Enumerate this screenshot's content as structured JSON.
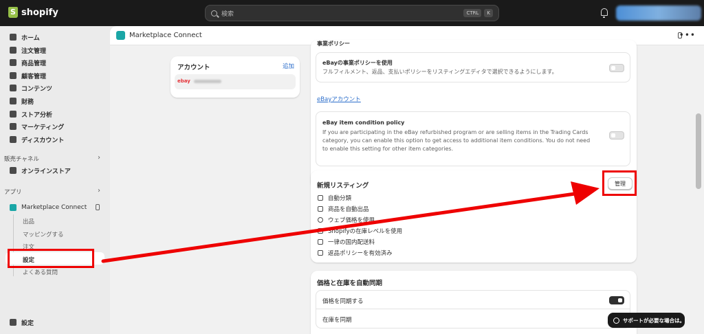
{
  "topbar": {
    "brand": "shopify",
    "search_placeholder": "検索",
    "kbd_ctrl": "CTRL",
    "kbd_k": "K"
  },
  "sidebar": {
    "items": [
      {
        "label": "ホーム",
        "icon": "home-icon"
      },
      {
        "label": "注文管理",
        "icon": "inbox-icon"
      },
      {
        "label": "商品管理",
        "icon": "tag-icon"
      },
      {
        "label": "顧客管理",
        "icon": "person-icon"
      },
      {
        "label": "コンテンツ",
        "icon": "image-icon"
      },
      {
        "label": "財務",
        "icon": "bank-icon"
      },
      {
        "label": "ストア分析",
        "icon": "chart-icon"
      },
      {
        "label": "マーケティング",
        "icon": "target-icon"
      },
      {
        "label": "ディスカウント",
        "icon": "discount-icon"
      }
    ],
    "sales_channels_label": "販売チャネル",
    "online_store": "オンラインストア",
    "apps_label": "アプリ",
    "app_name": "Marketplace Connect",
    "app_sub": [
      "出品",
      "マッピングする",
      "注文",
      "設定",
      "よくある質問"
    ],
    "settings": "設定"
  },
  "app_header": {
    "title": "Marketplace Connect"
  },
  "account_card": {
    "title": "アカウント",
    "add_link": "追加",
    "ebay_logo": "ebay"
  },
  "policy_card": {
    "section_title": "事業ポリシー",
    "business_policy_title": "eBayの事業ポリシーを使用",
    "business_policy_desc": "フルフィルメント、返品、支払いポリシーをリスティングエディタで選択できるようにします。",
    "ebay_account_link": "eBayアカウント",
    "condition_title": "eBay item condition policy",
    "condition_desc": "If you are participating in the eBay refurbished program or are selling items in the Trading Cards category, you can enable this option to get access to additional item conditions. You do not need to enable this setting for other item categories."
  },
  "new_listing_card": {
    "title": "新規リスティング",
    "manage_button": "管理",
    "features": [
      {
        "label": "自動分類",
        "icon": "box-icon"
      },
      {
        "label": "商品を自動出品",
        "icon": "clipboard-icon"
      },
      {
        "label": "ウェブ価格を使用",
        "icon": "dollar-icon"
      },
      {
        "label": "Shopifyの在庫レベルを使用",
        "icon": "inventory-icon"
      },
      {
        "label": "一律の国内配送料",
        "icon": "truck-icon"
      },
      {
        "label": "返品ポリシーを有効済み",
        "icon": "receipt-icon"
      }
    ]
  },
  "sync_card": {
    "title": "価格と在庫を自動同期",
    "sync_price": "価格を同期する",
    "sync_inventory": "在庫を同期"
  },
  "help_button": "サポートが必要な場合は。",
  "colors": {
    "annotation_red": "#e00000",
    "topbar": "#1a1a1a",
    "link": "#2c6ecb"
  }
}
